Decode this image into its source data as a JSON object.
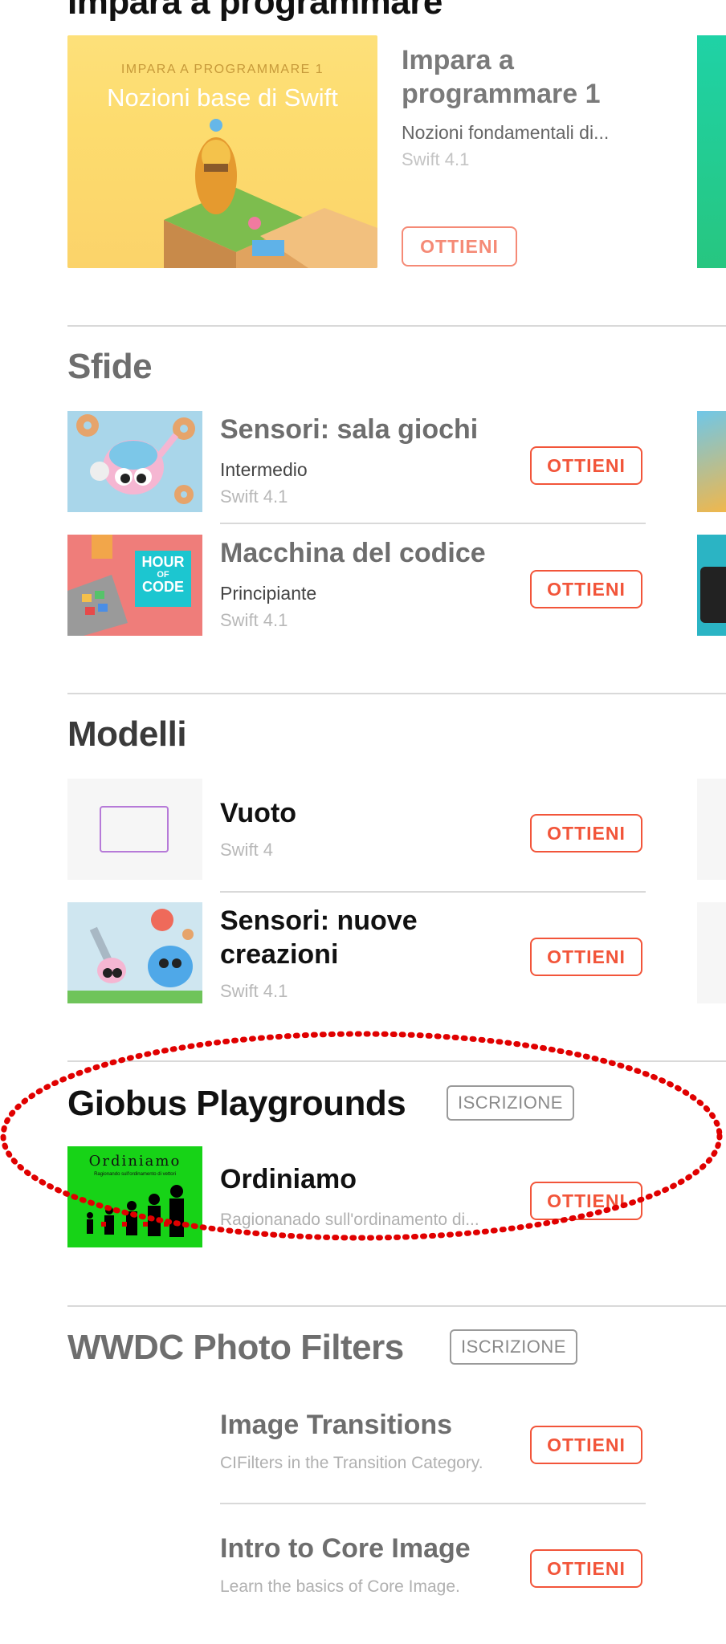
{
  "sections": {
    "learn": {
      "title": "Impara a programmare",
      "featured": {
        "banner_kicker": "IMPARA A PROGRAMMARE 1",
        "banner_title": "Nozioni base di Swift",
        "title": "Impara a programmare 1",
        "subtitle": "Nozioni fondamentali di...",
        "version": "Swift 4.1",
        "button": "OTTIENI"
      }
    },
    "challenges": {
      "title": "Sfide",
      "items": [
        {
          "title": "Sensori: sala giochi",
          "subtitle": "Intermedio",
          "version": "Swift 4.1",
          "button": "OTTIENI"
        },
        {
          "title": "Macchina del codice",
          "subtitle": "Principiante",
          "version": "Swift 4.1",
          "button": "OTTIENI",
          "thumb_text": [
            "HOUR",
            "OF",
            "CODE"
          ]
        }
      ]
    },
    "templates": {
      "title": "Modelli",
      "items": [
        {
          "title": "Vuoto",
          "version": "Swift 4",
          "button": "OTTIENI"
        },
        {
          "title_line1": "Sensori: nuove",
          "title_line2": "creazioni",
          "version": "Swift 4.1",
          "button": "OTTIENI"
        }
      ]
    },
    "giobus": {
      "title": "Giobus Playgrounds",
      "badge": "ISCRIZIONE",
      "items": [
        {
          "title": "Ordiniamo",
          "subtitle": "Ragionanado sull'ordinamento di...",
          "button": "OTTIENI",
          "thumb_title": "Ordiniamo",
          "thumb_caption": "Ragionando sull'ordinamento di vettori"
        }
      ]
    },
    "wwdc": {
      "title": "WWDC Photo Filters",
      "badge": "ISCRIZIONE",
      "items": [
        {
          "title": "Image Transitions",
          "subtitle": "CIFilters in the Transition Category.",
          "button": "OTTIENI"
        },
        {
          "title": "Intro to Core Image",
          "subtitle": "Learn the basics of Core Image.",
          "button": "OTTIENI"
        }
      ]
    }
  },
  "colors": {
    "accent": "#f2553a",
    "annotation": "#e00000",
    "separator": "#d9d9d9",
    "badge_border": "#9a9a9a"
  },
  "icons": [
    "robot-character-illustration",
    "donut-character-illustration",
    "hour-of-code-logo",
    "blank-template-frame",
    "spring-character-illustration",
    "people-sorting-silhouettes"
  ]
}
